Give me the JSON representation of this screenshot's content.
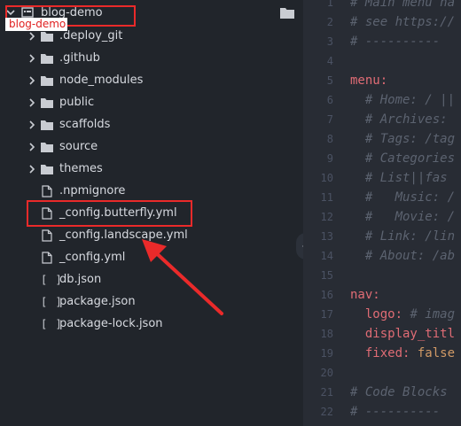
{
  "sidebar": {
    "root": {
      "label": "blog-demo",
      "tooltip": "blog-demo"
    },
    "items": [
      {
        "label": ".deploy_git",
        "type": "folder"
      },
      {
        "label": ".github",
        "type": "folder"
      },
      {
        "label": "node_modules",
        "type": "folder"
      },
      {
        "label": "public",
        "type": "folder"
      },
      {
        "label": "scaffolds",
        "type": "folder"
      },
      {
        "label": "source",
        "type": "folder"
      },
      {
        "label": "themes",
        "type": "folder"
      },
      {
        "label": ".npmignore",
        "type": "file"
      },
      {
        "label": "_config.butterfly.yml",
        "type": "file"
      },
      {
        "label": "_config.landscape.yml",
        "type": "file"
      },
      {
        "label": "_config.yml",
        "type": "file"
      },
      {
        "label": "db.json",
        "type": "json"
      },
      {
        "label": "package.json",
        "type": "json"
      },
      {
        "label": "package-lock.json",
        "type": "json"
      }
    ],
    "json_icon": "[ ]"
  },
  "editor": {
    "lines": [
      {
        "n": "1",
        "text": "# Main menu na",
        "style": "comment"
      },
      {
        "n": "2",
        "text": "# see https://",
        "style": "comment"
      },
      {
        "n": "3",
        "text": "# ----------",
        "style": "comment"
      },
      {
        "n": "4",
        "text": "",
        "style": "plain"
      },
      {
        "n": "5",
        "text": "menu:",
        "style": "key"
      },
      {
        "n": "6",
        "text": "  # Home: / ||",
        "style": "comment"
      },
      {
        "n": "7",
        "text": "  # Archives: ",
        "style": "comment"
      },
      {
        "n": "8",
        "text": "  # Tags: /tag",
        "style": "comment"
      },
      {
        "n": "9",
        "text": "  # Categories",
        "style": "comment"
      },
      {
        "n": "10",
        "text": "  # List||fas ",
        "style": "comment"
      },
      {
        "n": "11",
        "text": "  #   Music: /",
        "style": "comment"
      },
      {
        "n": "12",
        "text": "  #   Movie: /",
        "style": "comment"
      },
      {
        "n": "13",
        "text": "  # Link: /lin",
        "style": "comment"
      },
      {
        "n": "14",
        "text": "  # About: /ab",
        "style": "comment"
      },
      {
        "n": "15",
        "text": "",
        "style": "plain"
      },
      {
        "n": "16",
        "text": "nav:",
        "style": "key"
      },
      {
        "n": "17",
        "key": "  logo:",
        "rest": " # imag",
        "style": "mixed-comment"
      },
      {
        "n": "18",
        "text": "  display_titl",
        "style": "key"
      },
      {
        "n": "19",
        "key": "  fixed:",
        "rest": " false",
        "style": "mixed-value"
      },
      {
        "n": "20",
        "text": "",
        "style": "plain"
      },
      {
        "n": "21",
        "text": "# Code Blocks ",
        "style": "comment"
      },
      {
        "n": "22",
        "text": "# ----------",
        "style": "comment"
      }
    ]
  }
}
